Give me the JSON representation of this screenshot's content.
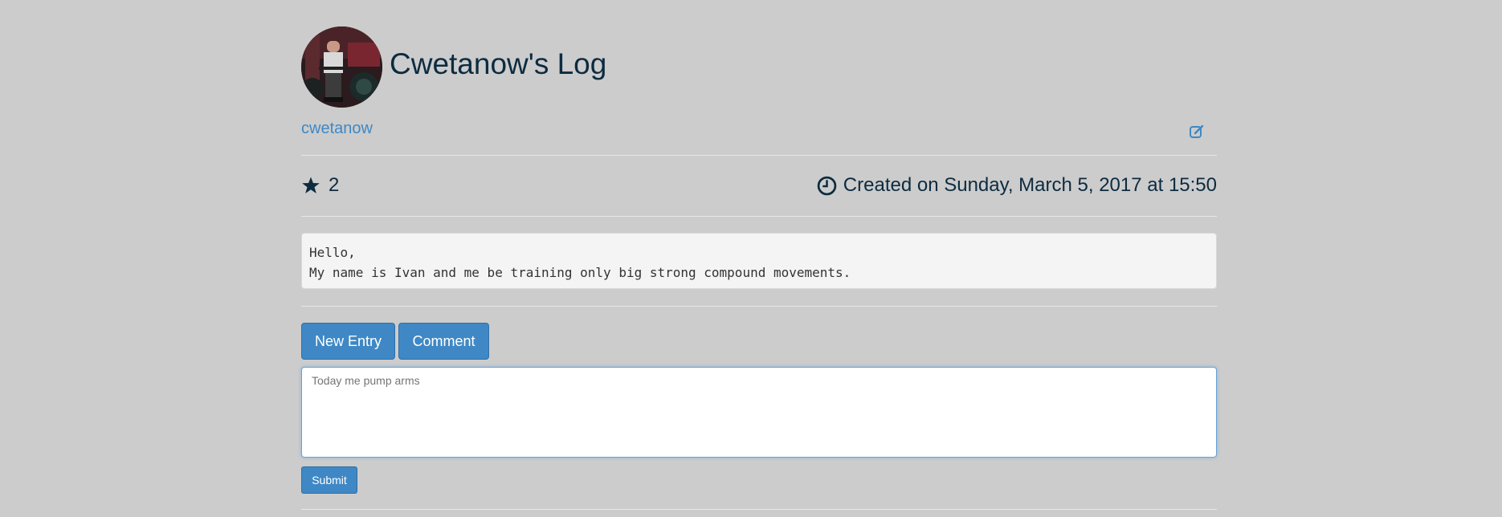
{
  "log": {
    "title": "Cwetanow's Log",
    "username": "cwetanow",
    "stars": "2",
    "created": "Created on Sunday, March 5, 2017 at 15:50",
    "description_lines": [
      "Hello,",
      "My name is Ivan and me be training only big strong compound movements."
    ]
  },
  "actions": {
    "new_entry_label": "New Entry",
    "comment_label": "Comment"
  },
  "entry_form": {
    "placeholder": "Today me pump arms",
    "value": "",
    "submit_label": "Submit"
  },
  "icons": {
    "avatar": "avatar-photo",
    "edit": "edit-icon",
    "star": "star-icon",
    "clock": "clock-icon"
  },
  "colors": {
    "background": "#cccccc",
    "accent": "#3f88c5",
    "text": "#0d2b40"
  }
}
